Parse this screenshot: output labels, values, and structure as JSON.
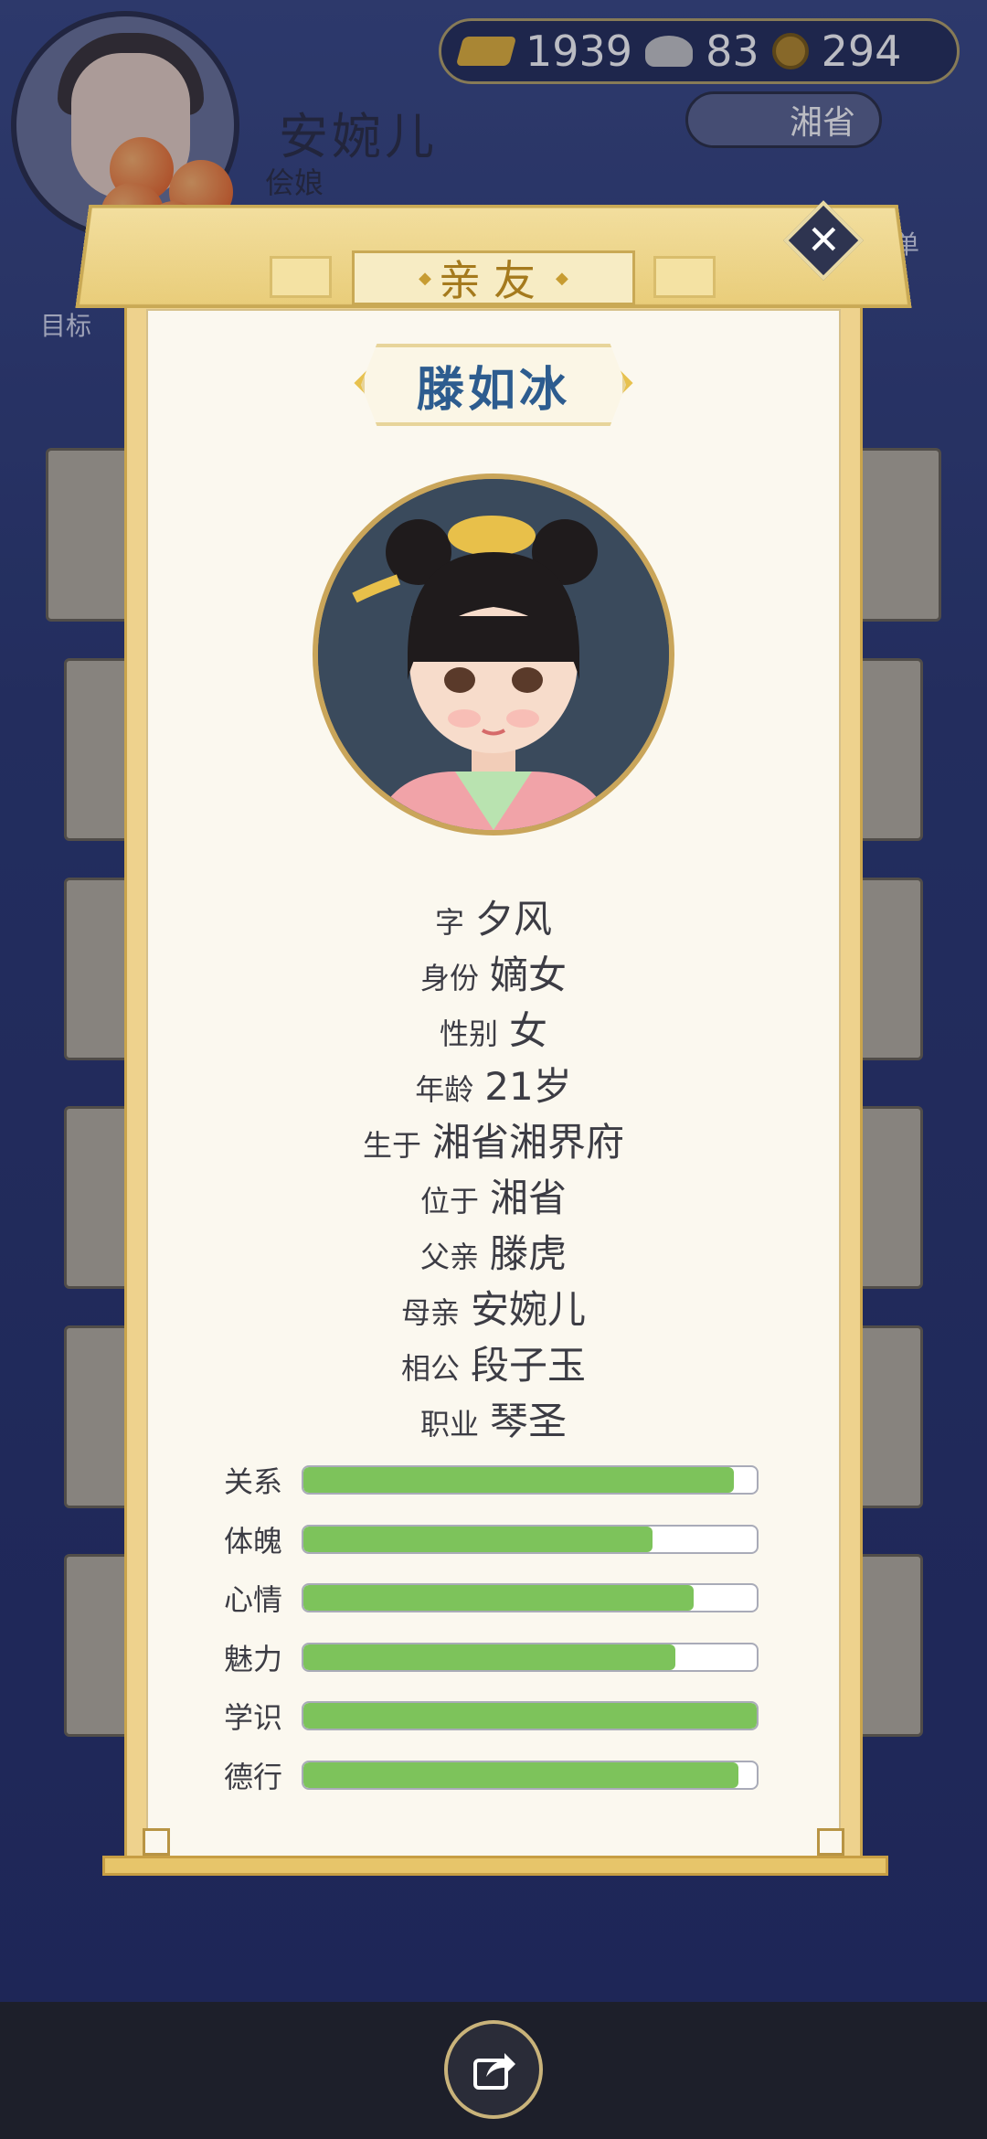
{
  "header": {
    "player_name": "安婉儿",
    "player_role": "侩娘",
    "currency": {
      "gold": "1939",
      "silver": "83",
      "coins": "294"
    },
    "province": "湘省",
    "target_label": "目标",
    "menu_label": "菜单"
  },
  "dialog": {
    "title": "亲友",
    "name": "滕如冰",
    "info": [
      {
        "k": "字",
        "v": "夕风"
      },
      {
        "k": "身份",
        "v": "嫡女"
      },
      {
        "k": "性别",
        "v": "女"
      },
      {
        "k": "年龄",
        "v": "21岁"
      },
      {
        "k": "生于",
        "v": "湘省湘界府"
      },
      {
        "k": "位于",
        "v": "湘省"
      },
      {
        "k": "父亲",
        "v": "滕虎"
      },
      {
        "k": "母亲",
        "v": "安婉儿"
      },
      {
        "k": "相公",
        "v": "段子玉"
      },
      {
        "k": "职业",
        "v": "琴圣"
      }
    ],
    "stats": [
      {
        "label": "关系",
        "value": 0.95
      },
      {
        "label": "体魄",
        "value": 0.77
      },
      {
        "label": "心情",
        "value": 0.86
      },
      {
        "label": "魅力",
        "value": 0.82
      },
      {
        "label": "学识",
        "value": 1.0
      },
      {
        "label": "德行",
        "value": 0.96
      }
    ]
  },
  "colors": {
    "bar_fill": "#7dc35b",
    "name_text": "#2d5c8f",
    "title_text": "#a57a1d"
  },
  "icons": {
    "close": "close-icon",
    "share": "share-icon"
  }
}
